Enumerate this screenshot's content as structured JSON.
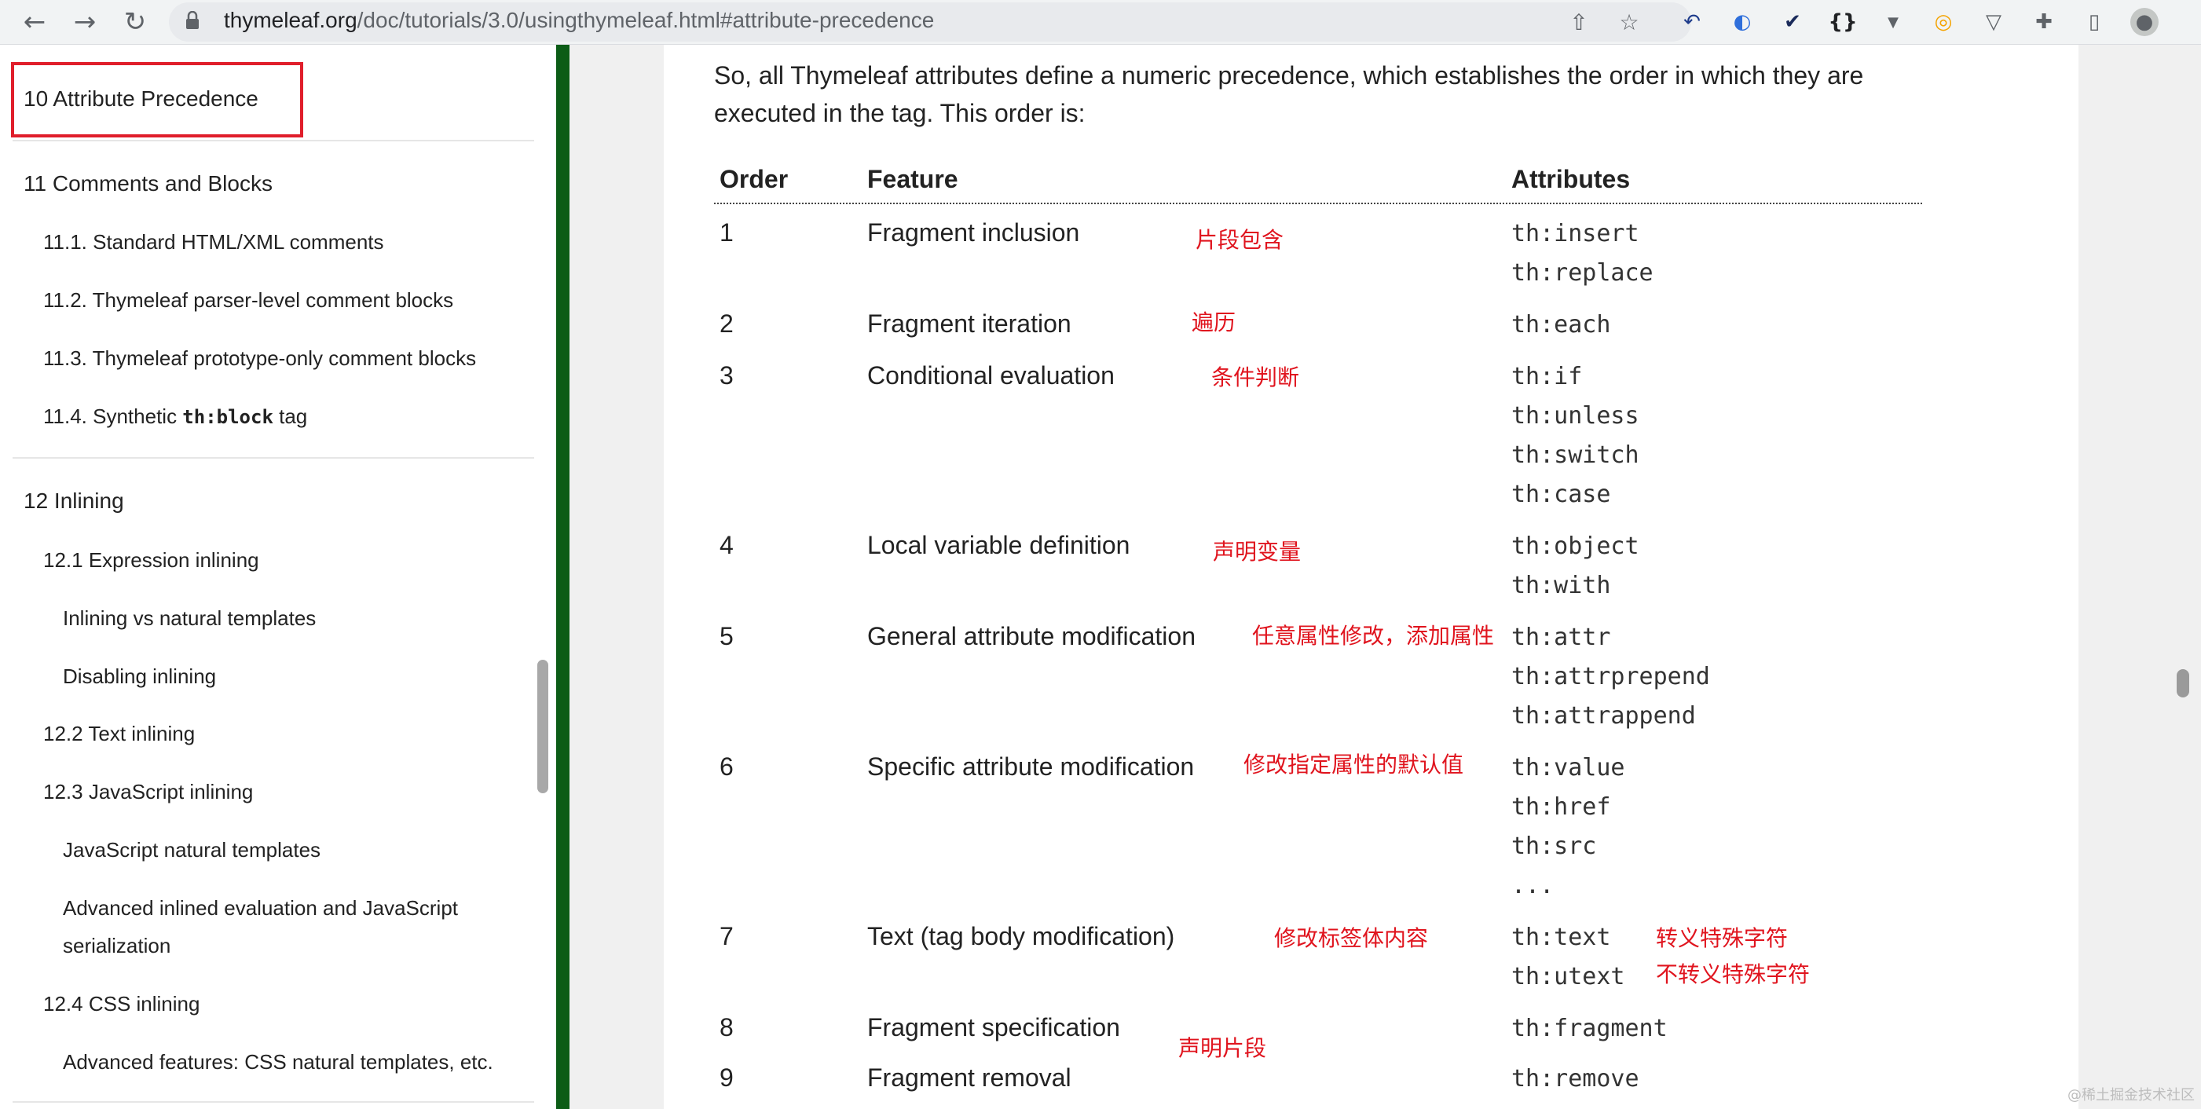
{
  "browser": {
    "url_host": "thymeleaf.org",
    "url_path": "/doc/tutorials/3.0/usingthymeleaf.html#attribute-precedence",
    "icons": [
      "back-icon",
      "forward-icon",
      "reload-icon",
      "lock-icon",
      "share-icon",
      "bookmark-star-icon",
      "extension-icons",
      "profile-icon"
    ]
  },
  "sidebar": {
    "highlighted": "10 Attribute Precedence",
    "items": [
      {
        "label": "11 Comments and Blocks"
      },
      {
        "label": "11.1. Standard HTML/XML comments"
      },
      {
        "label": "11.2. Thymeleaf parser-level comment blocks"
      },
      {
        "label": "11.3. Thymeleaf prototype-only comment blocks"
      },
      {
        "label_prefix": "11.4. Synthetic ",
        "label_code": "th:block",
        "label_suffix": " tag"
      },
      {
        "label": "12 Inlining"
      },
      {
        "label": "12.1 Expression inlining"
      },
      {
        "label": "Inlining vs natural templates"
      },
      {
        "label": "Disabling inlining"
      },
      {
        "label": "12.2 Text inlining"
      },
      {
        "label": "12.3 JavaScript inlining"
      },
      {
        "label": "JavaScript natural templates"
      },
      {
        "label": "Advanced inlined evaluation and JavaScript"
      },
      {
        "label": "serialization"
      },
      {
        "label": "12.4 CSS inlining"
      },
      {
        "label": "Advanced features: CSS natural templates, etc."
      }
    ]
  },
  "main": {
    "intro_line1": "So, all Thymeleaf attributes define a numeric precedence, which establishes the order in which they are",
    "intro_line2": "executed in the tag. This order is:",
    "headers": {
      "order": "Order",
      "feature": "Feature",
      "attributes": "Attributes"
    },
    "rows": [
      {
        "order": "1",
        "feature": "Fragment inclusion",
        "note": "片段包含",
        "attrs": [
          "th:insert",
          "th:replace"
        ]
      },
      {
        "order": "2",
        "feature": "Fragment iteration",
        "note": "遍历",
        "attrs": [
          "th:each"
        ]
      },
      {
        "order": "3",
        "feature": "Conditional evaluation",
        "note": "条件判断",
        "attrs": [
          "th:if",
          "th:unless",
          "th:switch",
          "th:case"
        ]
      },
      {
        "order": "4",
        "feature": "Local variable definition",
        "note": "声明变量",
        "attrs": [
          "th:object",
          "th:with"
        ]
      },
      {
        "order": "5",
        "feature": "General attribute modification",
        "note": "任意属性修改，添加属性",
        "attrs": [
          "th:attr",
          "th:attrprepend",
          "th:attrappend"
        ]
      },
      {
        "order": "6",
        "feature": "Specific attribute modification",
        "note": "修改指定属性的默认值",
        "attrs": [
          "th:value",
          "th:href",
          "th:src",
          "..."
        ]
      },
      {
        "order": "7",
        "feature": "Text (tag body modification)",
        "note": "修改标签体内容",
        "attrs": [
          "th:text",
          "th:utext"
        ],
        "attr_notes": [
          "转义特殊字符",
          "不转义特殊字符"
        ]
      },
      {
        "order": "8",
        "feature": "Fragment specification",
        "note": "声明片段",
        "attrs": [
          "th:fragment"
        ]
      },
      {
        "order": "9",
        "feature": "Fragment removal",
        "note": "",
        "attrs": [
          "th:remove"
        ]
      }
    ]
  },
  "watermark": "@稀土掘金技术社区"
}
